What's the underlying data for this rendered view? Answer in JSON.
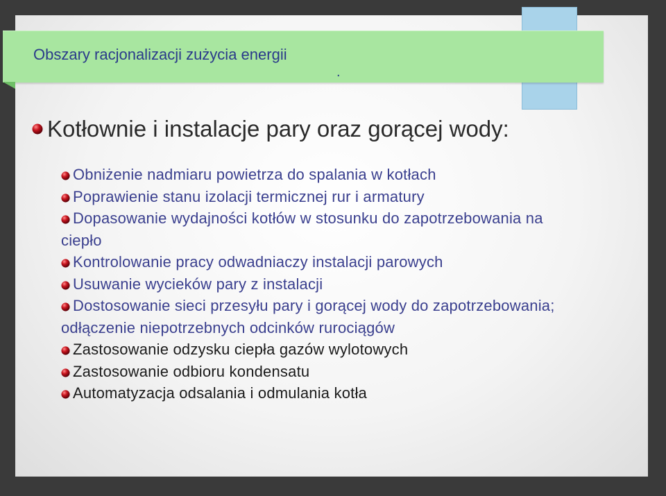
{
  "banner": {
    "title": "Obszary racjonalizacji zużycia energii",
    "dot": "."
  },
  "heading": "Kotłownie i instalacje pary oraz gorącej wody:",
  "items": [
    "Obniżenie nadmiaru powietrza do spalania w kotłach",
    "Poprawienie stanu izolacji termicznej rur i armatury",
    "Dopasowanie wydajności kotłów w stosunku do zapotrzebowania na ciepło",
    "Kontrolowanie pracy odwadniaczy instalacji parowych",
    "Usuwanie wycieków pary z instalacji",
    "Dostosowanie sieci przesyłu pary i gorącej wody do zapotrzebowania; odłączenie niepotrzebnych odcinków rurociągów",
    "Zastosowanie odzysku ciepła gazów wylotowych",
    "Zastosowanie odbioru kondensatu",
    "Automatyzacja odsalania i odmulania kotła"
  ],
  "colors": {
    "bullet": "#c8141e",
    "banner": "#a8e6a0",
    "tab": "#a9d3ea",
    "title": "#2a3a8a",
    "item_primary": "#3a3f8e",
    "item_secondary": "#1a1a1a"
  },
  "icons": {
    "bullet": "red-sphere-bullet-icon"
  }
}
